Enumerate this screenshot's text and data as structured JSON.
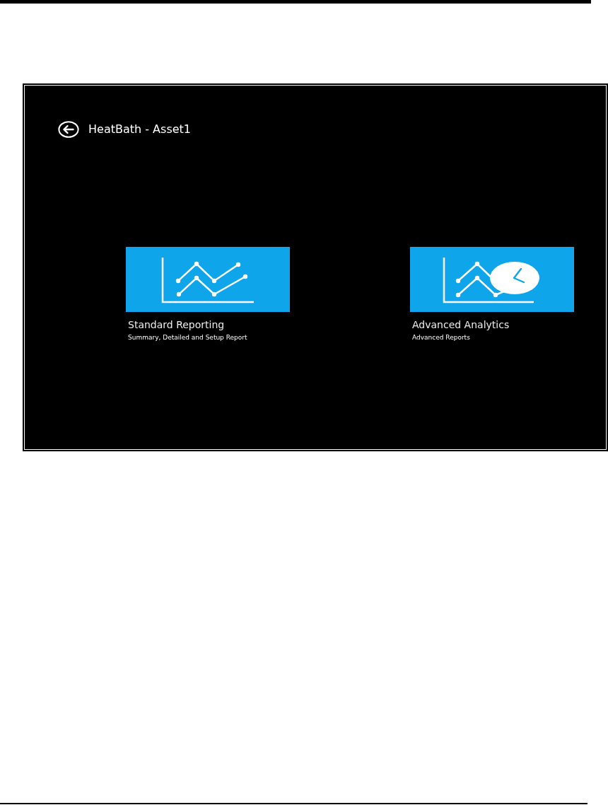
{
  "header": {
    "title": "HeatBath - Asset1"
  },
  "tiles": [
    {
      "kind": "chart",
      "title": "Standard Reporting",
      "subtitle": "Summary, Detailed and Setup Report"
    },
    {
      "kind": "chart-clock",
      "title": "Advanced Analytics",
      "subtitle": "Advanced Reports"
    }
  ]
}
